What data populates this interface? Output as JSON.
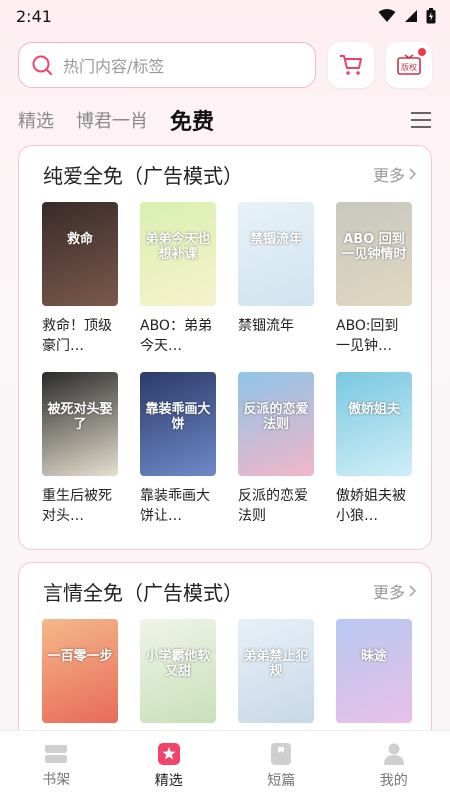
{
  "status": {
    "time": "2:41"
  },
  "search": {
    "placeholder": "热门内容/标签"
  },
  "badge_icon_label": "版权",
  "tabs": [
    {
      "label": "精选",
      "active": false
    },
    {
      "label": "博君一肖",
      "active": false
    },
    {
      "label": "免费",
      "active": true
    }
  ],
  "sections": [
    {
      "title": "纯爱全免（广告模式）",
      "more": "更多",
      "books": [
        {
          "title": "救命！顶级豪门…",
          "cover_text": "救命",
          "color1": "#3a2a2a",
          "color2": "#7a5a4a"
        },
        {
          "title": "ABO：弟弟今天…",
          "cover_text": "弟弟今天也想补课",
          "color1": "#d9f0b0",
          "color2": "#f6f2cc"
        },
        {
          "title": "禁锢流年",
          "cover_text": "禁锢流年",
          "color1": "#e8f2f8",
          "color2": "#cfe3ef"
        },
        {
          "title": "ABO:回到一见钟…",
          "cover_text": "ABO 回到一见钟情时",
          "color1": "#c8c8c0",
          "color2": "#e0d8c0"
        },
        {
          "title": "重生后被死对头…",
          "cover_text": "被死对头娶了",
          "color1": "#2a2a2a",
          "color2": "#e6e0d0"
        },
        {
          "title": "靠装乖画大饼让…",
          "cover_text": "靠装乖画大饼",
          "color1": "#2b3a6a",
          "color2": "#6f8ac8"
        },
        {
          "title": "反派的恋爱法则",
          "cover_text": "反派的恋爱法则",
          "color1": "#8fc4e8",
          "color2": "#f2b6c8"
        },
        {
          "title": "傲娇姐夫被小狼…",
          "cover_text": "傲娇姐夫",
          "color1": "#7ac8e0",
          "color2": "#d0eef8"
        }
      ]
    },
    {
      "title": "言情全免（广告模式）",
      "more": "更多",
      "books": [
        {
          "title": "",
          "cover_text": "一百零一步",
          "color1": "#f4b88a",
          "color2": "#e86a5a"
        },
        {
          "title": "",
          "cover_text": "小学霸他软又甜",
          "color1": "#f0f4e8",
          "color2": "#c8e0b8"
        },
        {
          "title": "",
          "cover_text": "弟弟禁止犯规",
          "color1": "#e8f0f8",
          "color2": "#c8d8e8"
        },
        {
          "title": "",
          "cover_text": "昧途",
          "color1": "#b8c8f0",
          "color2": "#e8c0e8"
        }
      ]
    }
  ],
  "nav": [
    {
      "label": "书架",
      "active": false
    },
    {
      "label": "精选",
      "active": true
    },
    {
      "label": "短篇",
      "active": false
    },
    {
      "label": "我的",
      "active": false
    }
  ],
  "colors": {
    "accent": "#f0446a",
    "border": "#f4c8d4"
  }
}
